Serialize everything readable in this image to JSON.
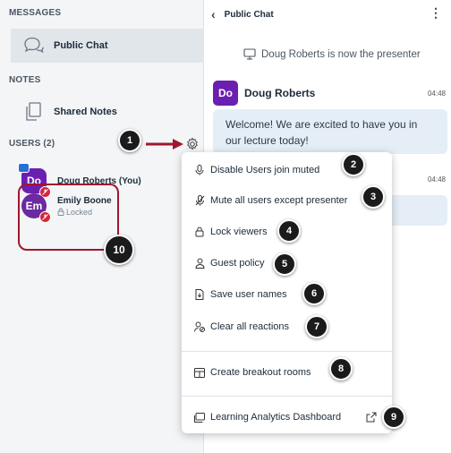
{
  "sidebar": {
    "messages_title": "MESSAGES",
    "public_chat": "Public Chat",
    "notes_title": "NOTES",
    "shared_notes": "Shared Notes",
    "users_title": "USERS (2)",
    "users": [
      {
        "initials": "Do",
        "name": "Doug Roberts (You)",
        "sub": ""
      },
      {
        "initials": "Em",
        "name": "Emily Boone",
        "sub": "Locked"
      }
    ]
  },
  "chat": {
    "title": "Public Chat",
    "system_message": "Doug Roberts is now the presenter",
    "messages": [
      {
        "initials": "Do",
        "author": "Doug Roberts",
        "time": "04:48",
        "text": "Welcome! We are excited to have you in our lecture today!"
      },
      {
        "time": "04:48"
      }
    ]
  },
  "menu": {
    "items": [
      {
        "label": "Disable Users join muted",
        "icon": "mic-icon"
      },
      {
        "label": "Mute all users except presenter",
        "icon": "mic-off-icon"
      },
      {
        "label": "Lock viewers",
        "icon": "lock-icon"
      },
      {
        "label": "Guest policy",
        "icon": "user-icon"
      },
      {
        "label": "Save user names",
        "icon": "save-file-icon"
      },
      {
        "label": "Clear all reactions",
        "icon": "clear-reactions-icon"
      },
      {
        "label": "Create breakout rooms",
        "icon": "breakout-rooms-icon"
      },
      {
        "label": "Learning Analytics Dashboard",
        "icon": "dashboard-icon"
      }
    ]
  },
  "callouts": [
    "1",
    "2",
    "3",
    "4",
    "5",
    "6",
    "7",
    "8",
    "9",
    "10"
  ],
  "colors": {
    "accent": "#6b1fb1",
    "highlight": "#a0172d",
    "bubble": "#e5eef7"
  }
}
